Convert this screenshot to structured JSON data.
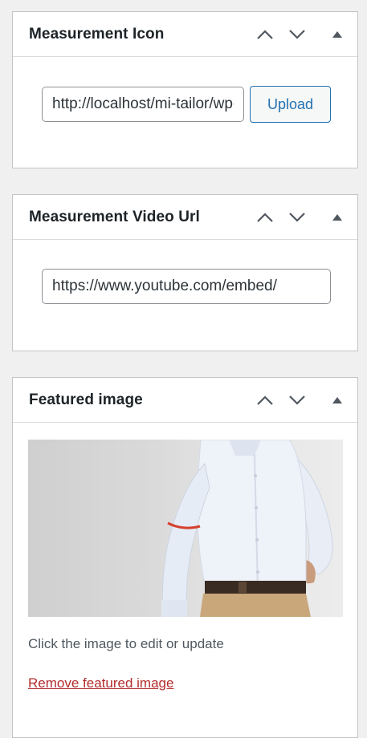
{
  "measurement_icon": {
    "title": "Measurement Icon",
    "input_value": "http://localhost/mi-tailor/wp-content/uploads/measure.png",
    "upload_label": "Upload"
  },
  "measurement_video": {
    "title": "Measurement Video Url",
    "input_value": "https://www.youtube.com/embed/"
  },
  "featured_image": {
    "title": "Featured image",
    "help_text": "Click the image to edit or update",
    "remove_label": "Remove featured image"
  },
  "colors": {
    "link_blue": "#2271b1",
    "remove_red": "#b32d2e",
    "panel_border": "#c3c4c7",
    "background": "#f0f0f1"
  },
  "icons": {
    "move_up": "chevron-up-icon",
    "move_down": "chevron-down-icon",
    "toggle": "triangle-up-icon"
  }
}
